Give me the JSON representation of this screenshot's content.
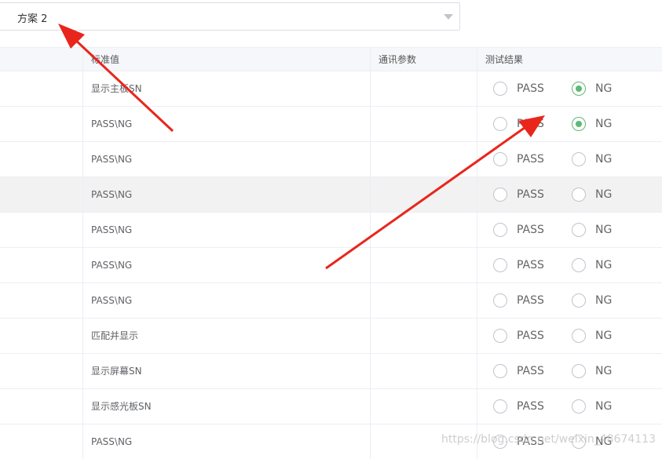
{
  "scheme_select": {
    "value": "方案 2"
  },
  "table": {
    "headers": {
      "standard": "标准值",
      "comm_params": "通讯参数",
      "result": "测试结果"
    },
    "rows": [
      {
        "standard": "显示主板SN",
        "pass": "PASS",
        "ng": "NG",
        "selected": "NG"
      },
      {
        "standard": "PASS\\NG",
        "pass": "PASS",
        "ng": "NG",
        "selected": "NG"
      },
      {
        "standard": "PASS\\NG",
        "pass": "PASS",
        "ng": "NG",
        "selected": ""
      },
      {
        "standard": "PASS\\NG",
        "pass": "PASS",
        "ng": "NG",
        "selected": ""
      },
      {
        "standard": "PASS\\NG",
        "pass": "PASS",
        "ng": "NG",
        "selected": ""
      },
      {
        "standard": "PASS\\NG",
        "pass": "PASS",
        "ng": "NG",
        "selected": ""
      },
      {
        "standard": "PASS\\NG",
        "pass": "PASS",
        "ng": "NG",
        "selected": ""
      },
      {
        "standard": "匹配并显示",
        "pass": "PASS",
        "ng": "NG",
        "selected": ""
      },
      {
        "standard": "显示屏幕SN",
        "pass": "PASS",
        "ng": "NG",
        "selected": ""
      },
      {
        "standard": "显示感光板SN",
        "pass": "PASS",
        "ng": "NG",
        "selected": ""
      },
      {
        "standard": "PASS\\NG",
        "pass": "PASS",
        "ng": "NG",
        "selected": ""
      }
    ]
  },
  "colors": {
    "checked": "#5fb878",
    "arrow": "#e8261c",
    "highlight_row": "#f2f2f2"
  },
  "watermark": "https://blog.csdn.net/weixin_48674113"
}
